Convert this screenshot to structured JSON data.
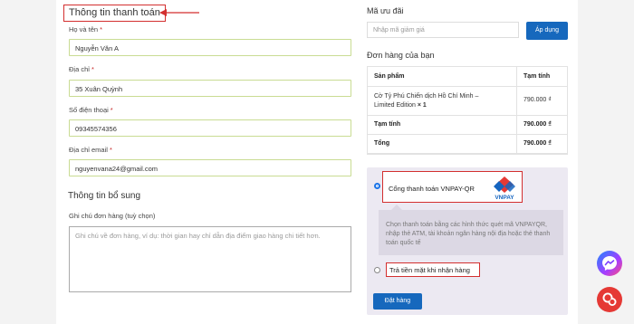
{
  "billing": {
    "title": "Thông tin thanh toán",
    "fields": {
      "name": {
        "label": "Họ và tên",
        "required": "*",
        "value": "Nguyễn Văn A"
      },
      "address": {
        "label": "Địa chỉ",
        "required": "*",
        "value": "35 Xuân Quỳnh"
      },
      "phone": {
        "label": "Số điện thoại",
        "required": "*",
        "value": "09345574356"
      },
      "email": {
        "label": "Địa chỉ email",
        "required": "*",
        "value": "nguyenvana24@gmail.com"
      }
    }
  },
  "additional": {
    "title": "Thông tin bổ sung",
    "notes_label": "Ghi chú đơn hàng (tuỳ chọn)",
    "notes_placeholder": "Ghi chú về đơn hàng, ví dụ: thời gian hay chỉ dẫn địa điểm giao hàng chi tiết hơn."
  },
  "coupon": {
    "title": "Mã ưu đãi",
    "placeholder": "Nhập mã giảm giá",
    "apply_label": "Áp dụng"
  },
  "order": {
    "title": "Đơn hàng của bạn",
    "col_product": "Sản phẩm",
    "col_subtotal": "Tạm tính",
    "item_name_line1": "Cờ Tỷ Phú Chiến dịch Hồ Chí Minh –",
    "item_name_line2": "Limited Edition",
    "item_qty": "× 1",
    "item_price": "790.000 ₫",
    "subtotal_label": "Tạm tính",
    "subtotal_value": "790.000 ₫",
    "total_label": "Tổng",
    "total_value": "790.000 ₫"
  },
  "payment": {
    "vnpay_label": "Cổng thanh toán VNPAY-QR",
    "vnpay_logo_text": "VNPAY",
    "vnpay_desc": "Chọn thanh toán bằng các hình thức quét mã VNPAYQR, nhập thẻ ATM, tài khoản ngân hàng nội địa hoặc thẻ thanh toán quốc tế",
    "cod_label": "Trả tiền mặt khi nhận hàng",
    "place_order_label": "Đặt hàng"
  },
  "colors": {
    "accent_blue": "#1668bd",
    "highlight_red": "#d32f2f",
    "field_border": "#c9dc93",
    "payment_bg": "#ece9f2"
  },
  "icons": [
    "messenger-icon",
    "chat-icon",
    "vnpay-logo-icon",
    "arrow-left-icon"
  ]
}
